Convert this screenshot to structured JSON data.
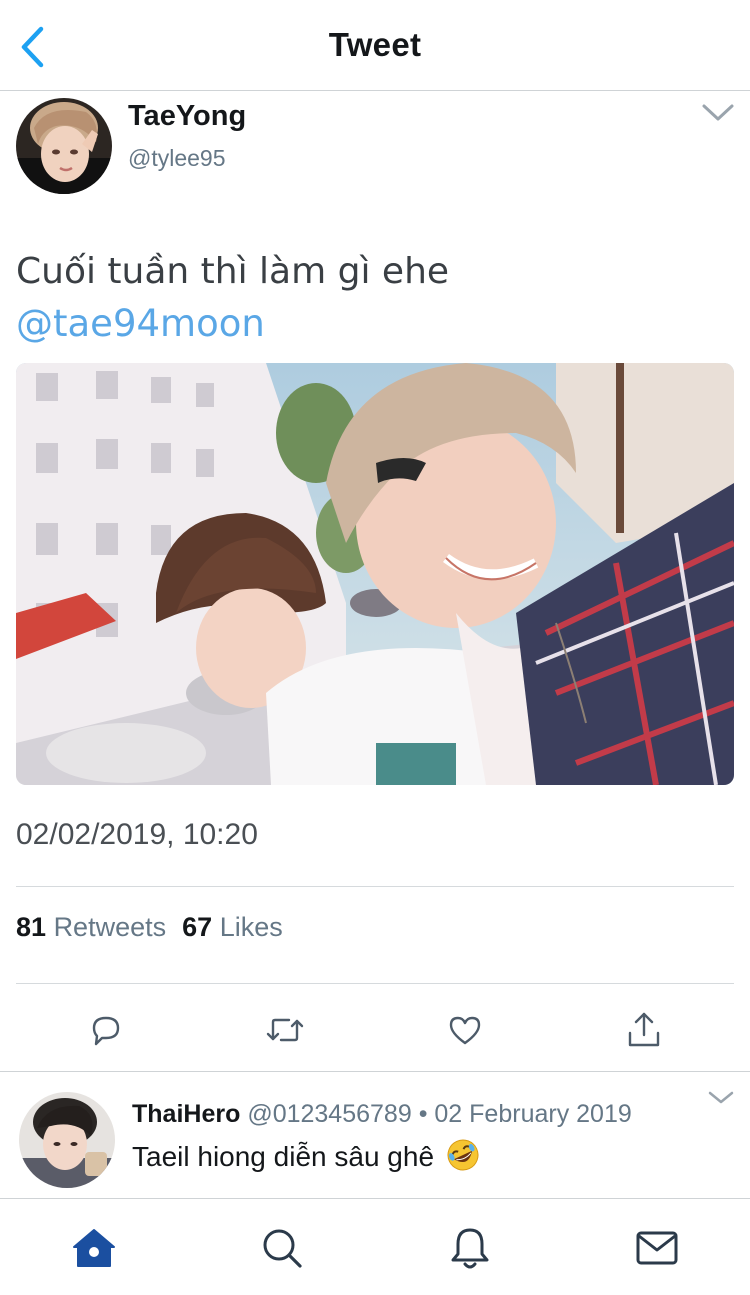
{
  "header": {
    "title": "Tweet",
    "back_icon": "chevron-left-icon"
  },
  "tweet": {
    "author_name": "TaeYong",
    "author_handle": "@tylee95",
    "text": "Cuối tuần thì làm gì ehe",
    "mention": "@tae94moon",
    "timestamp": "02/02/2019, 10:20",
    "retweets_count": "81",
    "retweets_label": "Retweets",
    "likes_count": "67",
    "likes_label": "Likes",
    "actions": [
      "reply-icon",
      "retweet-icon",
      "like-icon",
      "share-icon"
    ]
  },
  "reply": {
    "name": "ThaiHero",
    "handle": "@0123456789",
    "separator": "•",
    "date": "02 February 2019",
    "text": "Taeil hiong diễn sâu ghê",
    "emoji": "rolling-on-floor-laughing-emoji"
  },
  "tabbar": {
    "items": [
      "home-icon",
      "search-icon",
      "notifications-icon",
      "messages-icon"
    ],
    "active": "home-icon"
  },
  "colors": {
    "accent": "#1da1f2",
    "mention": "#5aa7e6",
    "secondary_text": "#657786",
    "divider": "#cfd3d6",
    "tab_active": "#1b4fa0",
    "tab_inactive": "#2b3a4a"
  }
}
